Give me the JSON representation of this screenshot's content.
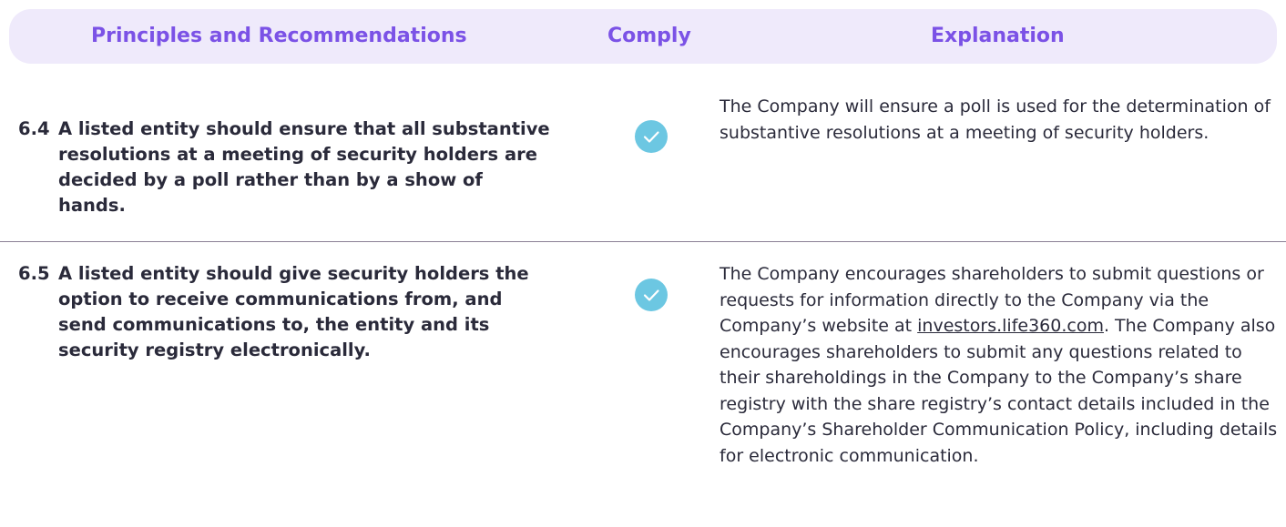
{
  "header": {
    "principles": "Principles and Recommendations",
    "comply": "Comply",
    "explanation": "Explanation"
  },
  "rows": [
    {
      "number": "6.4",
      "principle": "A listed entity should ensure that all substantive resolutions at a meeting of security holders are decided by a poll rather than by a show of hands.",
      "explanation": "The Company will ensure a poll is used for the determination of substantive resolutions at a meeting of security holders."
    },
    {
      "number": "6.5",
      "principle": "A listed entity should give security holders the option to receive communications from, and send communications to, the entity and its security registry electronically.",
      "explanation_before": "The Company encourages shareholders to submit questions or requests for information directly to the Company via the Company’s website at",
      "explanation_link": "investors.life360.com",
      "explanation_after": ". The Company also encourages shareholders to submit any questions related to their shareholdings in the Company to the Company’s share registry with the share registry’s contact details included in the Company’s Shareholder Communication Policy, including details for electronic communication."
    }
  ],
  "colors": {
    "header_bg": "#efeafb",
    "header_text": "#7b52e6",
    "check": "#6cc7e2",
    "divider": "#8a7f95"
  },
  "icons": {
    "comply_mark": "check-circle-icon"
  }
}
